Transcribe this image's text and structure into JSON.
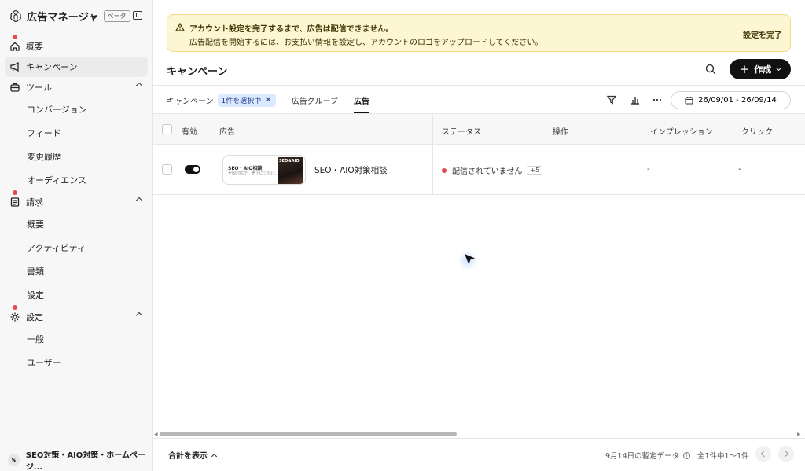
{
  "app": {
    "title": "広告マネージャ",
    "beta": "ベータ"
  },
  "sidebar": {
    "items": [
      {
        "label": "概要",
        "icon": "home-icon",
        "has_dot": true
      },
      {
        "label": "キャンペーン",
        "icon": "megaphone-icon",
        "active": true
      },
      {
        "label": "ツール",
        "icon": "toolbox-icon",
        "expanded": true
      },
      {
        "label": "請求",
        "icon": "receipt-icon",
        "has_dot": true,
        "expanded": true
      },
      {
        "label": "設定",
        "icon": "gear-icon",
        "has_dot": true,
        "expanded": true
      }
    ],
    "tools_sub": [
      "コンバージョン",
      "フィード",
      "変更履歴",
      "オーディエンス"
    ],
    "billing_sub": [
      "概要",
      "アクティビティ",
      "書類",
      "設定"
    ],
    "settings_sub": [
      "一般",
      "ユーザー"
    ],
    "account": {
      "initial": "S",
      "name": "SEO対策・AIO対策・ホームページ..."
    }
  },
  "banner": {
    "title": "アカウント設定を完了するまで、広告は配信できません。",
    "body": "広告配信を開始するには、お支払い情報を設定し、アカウントのロゴをアップロードしてください。",
    "cta": "設定を完了"
  },
  "header": {
    "title": "キャンペーン",
    "create_label": "作成"
  },
  "tabs": {
    "campaign": "キャンペーン",
    "chip": "1件を選択中",
    "adgroup": "広告グループ",
    "ad": "広告"
  },
  "date_range": "26/09/01 - 26/09/14",
  "table": {
    "headers": {
      "enabled": "有効",
      "ad": "広告",
      "status": "ステータス",
      "action": "操作",
      "impressions": "インプレッション",
      "clicks": "クリック"
    },
    "rows": [
      {
        "thumb_title": "SEO・AIO相談",
        "thumb_sub": "全国対応で、売上につなげ...",
        "thumb_image_text": "SEO&AIO",
        "name": "SEO・AIO対策相談",
        "status": "配信されていません",
        "status_more": "+5",
        "impressions": "-",
        "clicks": "-"
      }
    ]
  },
  "footer": {
    "totals": "合計を表示",
    "estimate": "9月14日の暫定データ",
    "pager": "全1件中1〜1件"
  },
  "colors": {
    "banner_bg": "#fdf6d3",
    "accent": "#111111",
    "status_dot": "#d9484f",
    "chip_bg": "#dbeafe"
  }
}
